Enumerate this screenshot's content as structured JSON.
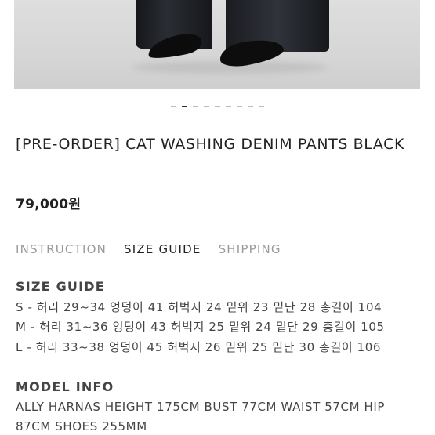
{
  "product": {
    "title": "[PRE-ORDER] CAT WASHING DENIM PANTS BLACK",
    "price": "79,000원"
  },
  "carousel": {
    "dot_count": 9,
    "active_index": 1
  },
  "tabs": [
    {
      "label": "INSTRUCTION",
      "active": false
    },
    {
      "label": "SIZE GUIDE",
      "active": true
    },
    {
      "label": "SHIPPING",
      "active": false
    }
  ],
  "size_guide": {
    "heading": "SIZE GUIDE",
    "rows": [
      "S - 허리 29~34 엉덩이 41 허벅지 24 밑위 23 밑단 28 총길이 104",
      "M - 허리 31~36 엉덩이 43 허벅지 25 밑위 24 밑단 29 총길이 105",
      "L - 허리 33~38 엉덩이 45 허벅지 26 밑위 25 밑단 30 총길이 106"
    ]
  },
  "model_info": {
    "heading": "MODEL INFO",
    "lines": [
      "ALLY HARNAS HEIGHT 175CM BUST 77CM WAIST 57CM HIP",
      "87CM SHOES 255MM"
    ]
  }
}
